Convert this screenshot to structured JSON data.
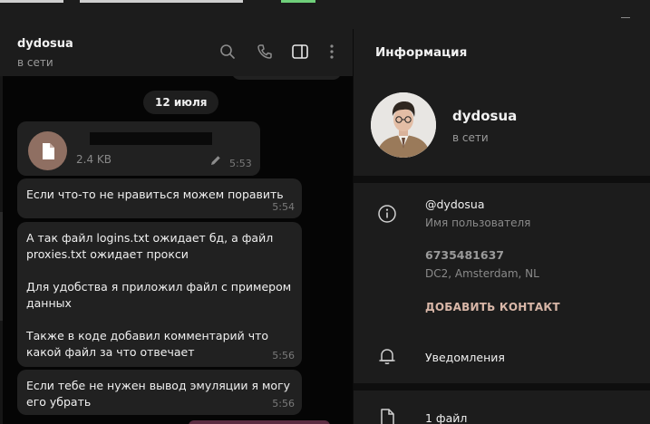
{
  "chat": {
    "title": "dydosua",
    "status": "в сети",
    "date_separator": "12 июля",
    "file_message": {
      "size": "2.4 KB",
      "time": "5:53"
    },
    "messages": [
      {
        "text": "Если что-то не нравиться можем поравить",
        "time": "5:54"
      },
      {
        "text": "А так файл logins.txt ожидает бд, а файл proxies.txt ожидает прокси\n\nДля удобства я приложил файл с примером данных\n\nТакже в коде добавил комментарий что какой файл за что отвечает",
        "time": "5:56"
      },
      {
        "text": "Если тебе не нужен вывод эмуляции я могу его убрать",
        "time": "5:56"
      }
    ]
  },
  "info": {
    "title": "Информация",
    "name": "dydosua",
    "status": "в сети",
    "username": "@dydosua",
    "username_label": "Имя пользователя",
    "id_value": "6735481637",
    "dc_label": "DC2, Amsterdam, NL",
    "add_contact": "ДОБАВИТЬ КОНТАКТ",
    "notifications_label": "Уведомления",
    "files_label": "1 файл"
  },
  "colors": {
    "accent": "#d9b7a8",
    "panel_bg": "#1c1c1c",
    "bubble_bg": "#212121",
    "chat_bg": "#050505",
    "online_green": "#6fcf7a"
  },
  "icons": [
    "search-icon",
    "phone-icon",
    "sidebar-toggle-icon",
    "more-vertical-icon",
    "file-icon",
    "pencil-icon",
    "info-icon",
    "bell-icon",
    "document-icon"
  ]
}
